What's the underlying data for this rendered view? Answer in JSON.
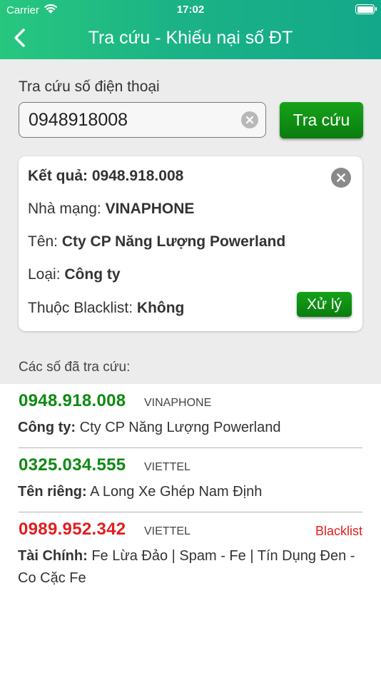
{
  "status_bar": {
    "carrier": "Carrier",
    "time": "17:02"
  },
  "nav": {
    "title": "Tra cứu - Khiếu nại số ĐT"
  },
  "search": {
    "label": "Tra cứu số điện thoại",
    "value": "0948918008",
    "button_label": "Tra cứu"
  },
  "result": {
    "title_label": "Kết quả:",
    "title_value": "0948.918.008",
    "carrier_label": "Nhà mạng:",
    "carrier_value": "VINAPHONE",
    "name_label": "Tên:",
    "name_value": "Cty CP Năng Lượng Powerland",
    "type_label": "Loại:",
    "type_value": "Công ty",
    "blacklist_label": "Thuộc Blacklist:",
    "blacklist_value": "Không",
    "process_button": "Xử lý"
  },
  "history": {
    "label": "Các số đã tra cứu:",
    "items": [
      {
        "phone": "0948.918.008",
        "carrier": "VINAPHONE",
        "flag": "",
        "category": "Công ty:",
        "text": "Cty CP Năng Lượng Powerland",
        "color": "#0d8a12"
      },
      {
        "phone": "0325.034.555",
        "carrier": "VIETTEL",
        "flag": "",
        "category": "Tên riêng:",
        "text": "A Long Xe Ghép Nam Định",
        "color": "#0d8a12"
      },
      {
        "phone": "0989.952.342",
        "carrier": "VIETTEL",
        "flag": "Blacklist",
        "category": "Tài Chính:",
        "text": "Fe Lừa Đảo | Spam - Fe | Tín Dụng Đen - Co Cặc Fe",
        "color": "#e01e1e"
      }
    ]
  },
  "colors": {
    "header": "#1bb386",
    "button": "#0a7c0e",
    "phone_ok": "#0d8a12",
    "phone_bad": "#e01e1e"
  }
}
